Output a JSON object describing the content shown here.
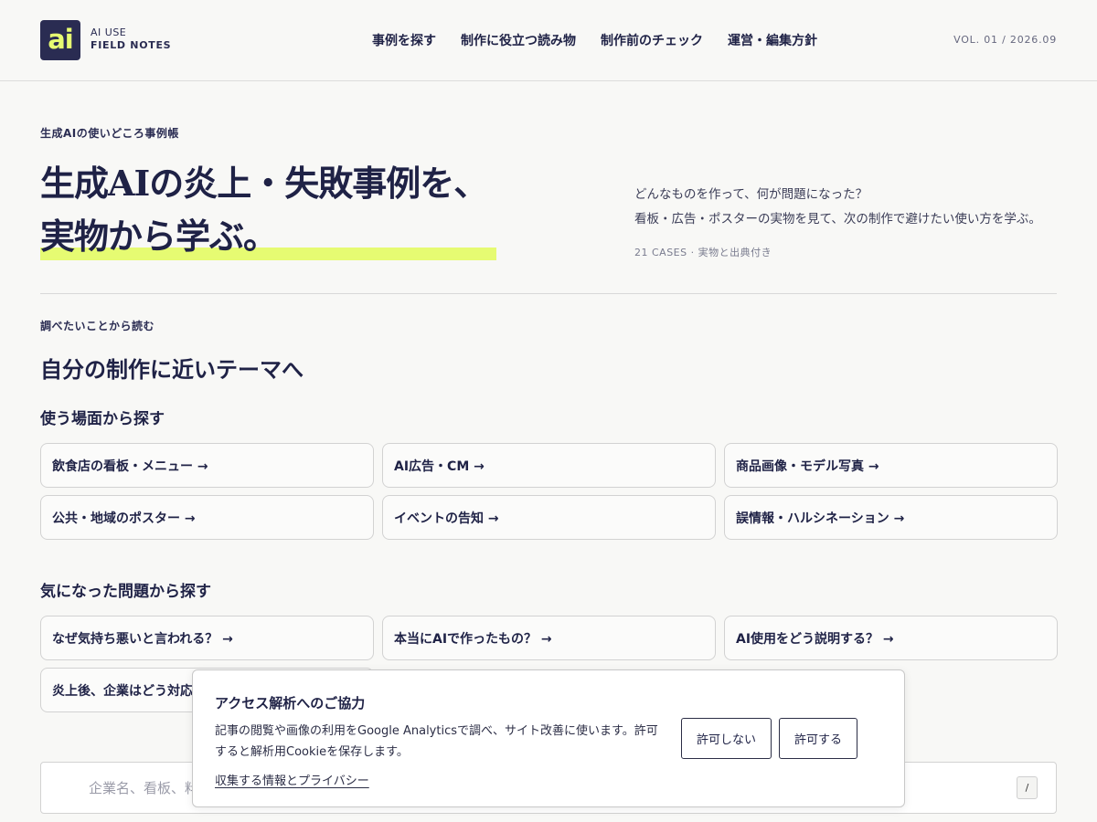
{
  "header": {
    "logo_text": "ai",
    "brand_line1": "AI USE",
    "brand_line2": "FIELD NOTES",
    "nav": [
      "事例を探す",
      "制作に役立つ読み物",
      "制作前のチェック",
      "運営・編集方針"
    ],
    "volume": "VOL. 01 / 2026.09"
  },
  "hero": {
    "eyebrow": "生成AIの使いどころ事例帳",
    "title_line1": "生成AIの炎上・失敗事例を、",
    "title_line2": "実物から学ぶ。",
    "desc_line1": "どんなものを作って、何が問題になった？",
    "desc_line2": "看板・広告・ポスターの実物を見て、次の制作で避けたい使い方を学ぶ。",
    "count": "21 CASES · 実物と出典付き"
  },
  "themes": {
    "eyebrow": "調べたいことから読む",
    "title": "自分の制作に近いテーマへ",
    "scene_title": "使う場面から探す",
    "scene_items": [
      "飲食店の看板・メニュー →",
      "AI広告・CM →",
      "商品画像・モデル写真 →",
      "公共・地域のポスター →",
      "イベントの告知 →",
      "誤情報・ハルシネーション →"
    ],
    "problem_title": "気になった問題から探す",
    "problem_items": [
      "なぜ気持ち悪いと言われる？ →",
      "本当にAIで作ったもの？ →",
      "AI使用をどう説明する？ →",
      "炎上後、企業はどう対応"
    ]
  },
  "search": {
    "placeholder": "企業名、看板、料",
    "shortcut": "/"
  },
  "consent": {
    "title": "アクセス解析へのご協力",
    "text": "記事の閲覧や画像の利用をGoogle Analyticsで調べ、サイト改善に使います。許可すると解析用Cookieを保存します。",
    "link": "収集する情報とプライバシー",
    "deny_label": "許可しない",
    "allow_label": "許可する"
  },
  "colors": {
    "accent": "#e6fb72",
    "navy": "#2a2c52",
    "background": "#f8f8f6"
  }
}
